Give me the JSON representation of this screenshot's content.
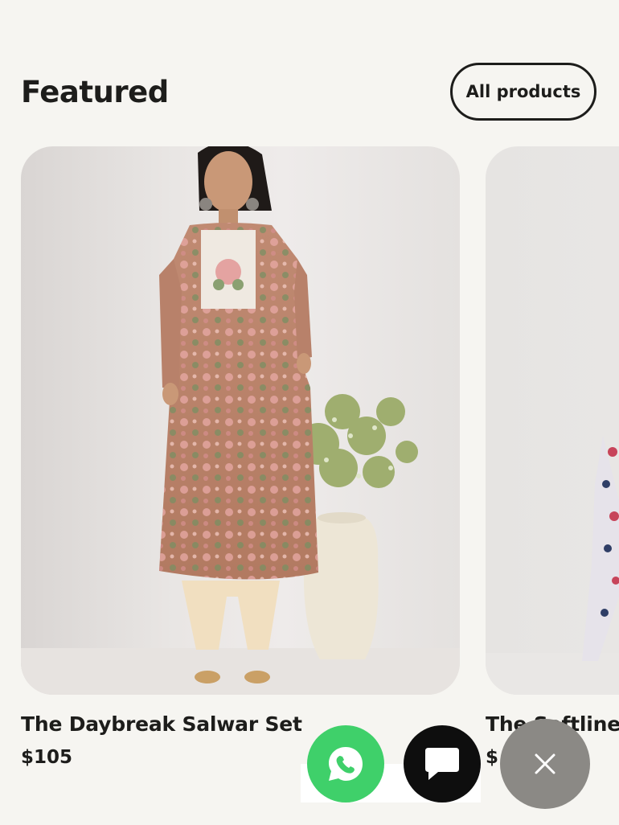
{
  "section": {
    "title": "Featured",
    "all_products_label": "All products"
  },
  "products": [
    {
      "title": "The Daybreak Salwar Set",
      "price": "$105"
    },
    {
      "title": "The Softline",
      "price": "$"
    }
  ],
  "colors": {
    "background": "#f6f5f1",
    "text": "#1d1d1b",
    "whatsapp": "#3fd06a",
    "chat": "#0e0e0e",
    "close": "#8b8985"
  },
  "icons": {
    "whatsapp": "whatsapp-icon",
    "chat": "chat-bubble-icon",
    "close": "close-icon"
  }
}
